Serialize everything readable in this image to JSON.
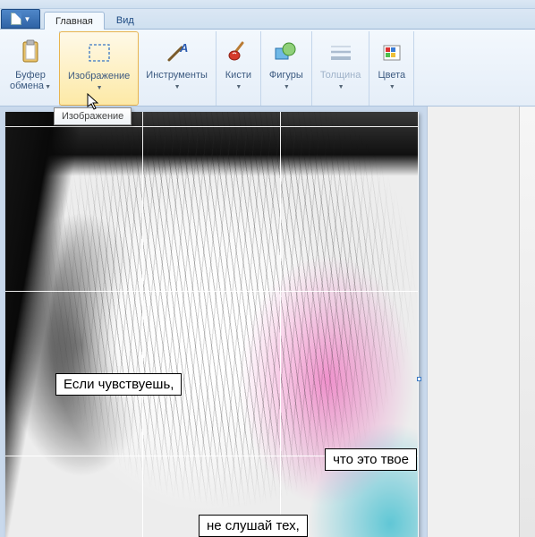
{
  "tabs": {
    "main": "Главная",
    "view": "Вид"
  },
  "ribbon": {
    "clipboard": {
      "label1": "Буфер",
      "label2": "обмена"
    },
    "image": "Изображение",
    "tools": "Инструменты",
    "brushes": "Кисти",
    "shapes": "Фигуры",
    "thickness": "Толщина",
    "colors": "Цвета"
  },
  "tooltip": "Изображение",
  "canvas_text": {
    "line1": "Если чувствуешь,",
    "line2": "что это твое",
    "line3": "не слушай тех,"
  }
}
